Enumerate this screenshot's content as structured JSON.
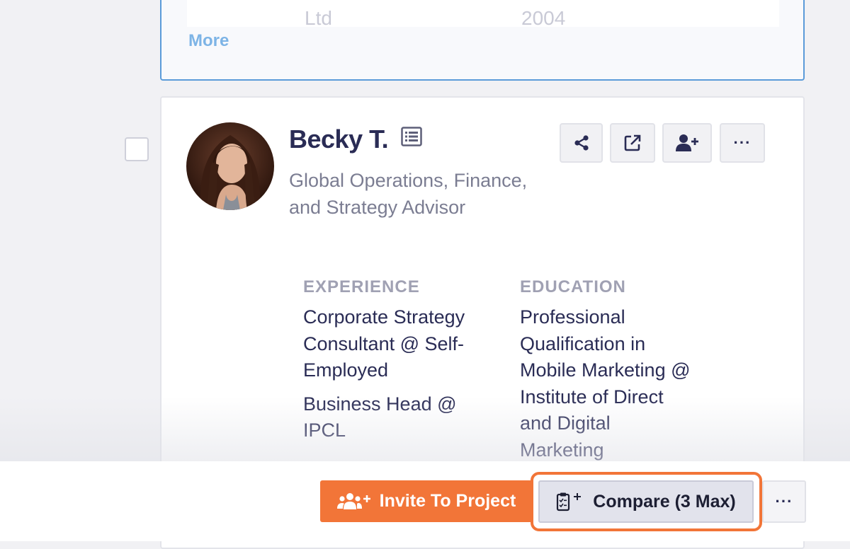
{
  "previous_card": {
    "experience_fragment": "Ltd",
    "education_fragment": "2004",
    "more_label": "More"
  },
  "profile": {
    "name": "Becky T.",
    "headline_line1": "Global Operations, Finance,",
    "headline_line2": "and Strategy Advisor",
    "experience_title": "EXPERIENCE",
    "experience": [
      "Corporate Strategy Consultant @ Self-Employed",
      "Business Head @ IPCL"
    ],
    "education_title": "EDUCATION",
    "education": [
      "Professional Qualification in Mobile Marketing @ Institute of Direct and Digital Marketing"
    ]
  },
  "bottom_bar": {
    "invite_label": "Invite To Project",
    "compare_label": "Compare (3 Max)",
    "more_label": "···"
  },
  "colors": {
    "accent_orange": "#f27538",
    "selected_border_blue": "#5b9bd9",
    "link_blue": "#7db4e6",
    "name_navy": "#2a2c55"
  },
  "icons": [
    "share-icon",
    "external-link-icon",
    "add-user-icon",
    "ellipsis-icon",
    "list-icon",
    "group-add-icon",
    "clipboard-compare-icon"
  ]
}
